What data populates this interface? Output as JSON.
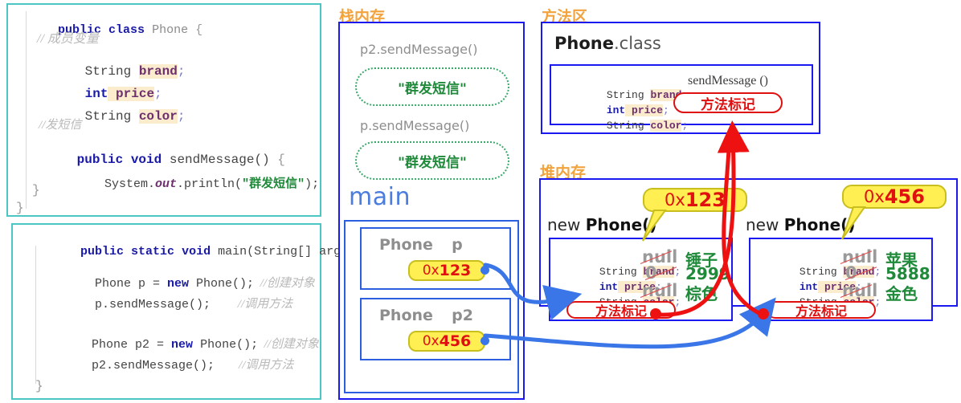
{
  "diagram": {
    "title_stack": "栈内存",
    "title_method_area": "方法区",
    "title_heap": "堆内存"
  },
  "code_top": {
    "lines": [
      {
        "id": "l1",
        "text": "public class Phone {"
      },
      {
        "id": "l2",
        "text": "// 成员变量"
      },
      {
        "id": "l3",
        "text": "String brand;"
      },
      {
        "id": "l4",
        "text": "int price;"
      },
      {
        "id": "l5",
        "text": "String color;"
      },
      {
        "id": "l6",
        "text": "//发短信"
      },
      {
        "id": "l7",
        "text": "public void sendMessage() {"
      },
      {
        "id": "l8",
        "text": "System.out.println(\"群发短信\");"
      },
      {
        "id": "l9",
        "text": "}"
      },
      {
        "id": "l10",
        "text": "}"
      }
    ],
    "tokens": {
      "public": "public",
      "class": "class",
      "phone": "Phone",
      "brace_open": "{",
      "brace_close": "}",
      "comment_member": "// 成员变量",
      "string_kw": "String",
      "brand": "brand",
      "int_kw": "int",
      "price": "price",
      "color": "color",
      "semi": ";",
      "comment_send": "//发短信",
      "void_kw": "void",
      "send_message": "sendMessage",
      "parens": "()",
      "system": "System.",
      "out": "out",
      "println": ".println(",
      "msg": "\"群发短信\"",
      "close_paren_semi": ");"
    }
  },
  "code_bottom": {
    "tokens": {
      "public": "public",
      "static": "static",
      "void": "void",
      "main_sig": "main(String[] args)  {",
      "decl_p": "Phone p = ",
      "new_kw": "new",
      "phone_call": " Phone();",
      "cmt_create": "//创建对象",
      "call_p": "p.sendMessage();",
      "cmt_call": "//调用方法",
      "decl_p2": "Phone p2 = ",
      "call_p2": "p2.sendMessage();",
      "brace_close": "}"
    }
  },
  "stack": {
    "frames": [
      {
        "label": "p2.sendMessage()",
        "output": "\"群发短信\""
      },
      {
        "label": "p.sendMessage()",
        "output": "\"群发短信\""
      }
    ],
    "main_label": "main",
    "variables": [
      {
        "type": "Phone",
        "name": "p",
        "address_prefix": "0x",
        "address_value": "123"
      },
      {
        "type": "Phone",
        "name": "p2",
        "address_prefix": "0x",
        "address_value": "456"
      }
    ]
  },
  "method_area": {
    "class_name": "Phone",
    "class_suffix": ".class",
    "fields": [
      {
        "type": "String",
        "name": "brand",
        "semi": ";"
      },
      {
        "type": "int",
        "name": "price",
        "semi": ";"
      },
      {
        "type": "String",
        "name": "color",
        "semi": ";"
      }
    ],
    "method_name": "sendMessage ()",
    "method_tag": "方法标记"
  },
  "heap": {
    "objects": [
      {
        "header_new": "new ",
        "header_name": "Phone()",
        "callout_prefix": "0x",
        "callout_value": "123",
        "fields": [
          {
            "type": "String",
            "name": "brand",
            "semi": ";",
            "default_value": "null",
            "assigned_value": "锤子"
          },
          {
            "type": "int",
            "name": "price",
            "semi": ";",
            "default_value": "0",
            "assigned_value": "2999"
          },
          {
            "type": "String",
            "name": "color",
            "semi": ";",
            "default_value": "null",
            "assigned_value": "棕色"
          }
        ],
        "method_tag": "方法标记"
      },
      {
        "header_new": "new ",
        "header_name": "Phone()",
        "callout_prefix": "0x",
        "callout_value": "456",
        "fields": [
          {
            "type": "String",
            "name": "brand",
            "semi": ";",
            "default_value": "null",
            "assigned_value": "苹果"
          },
          {
            "type": "int",
            "name": "price",
            "semi": ";",
            "default_value": "0",
            "assigned_value": "5888"
          },
          {
            "type": "String",
            "name": "color",
            "semi": ";",
            "default_value": "null",
            "assigned_value": "金色"
          }
        ],
        "method_tag": "方法标记"
      }
    ]
  },
  "colors": {
    "code_border": "#4cc6c3",
    "box_border": "#1a1af0",
    "heading": "#f2a33c",
    "address_pill": "#ffef52",
    "red": "#e01010",
    "green": "#1f8a3a",
    "blue_arrow": "#3a76e8",
    "gray_label": "#8e8e8e"
  }
}
